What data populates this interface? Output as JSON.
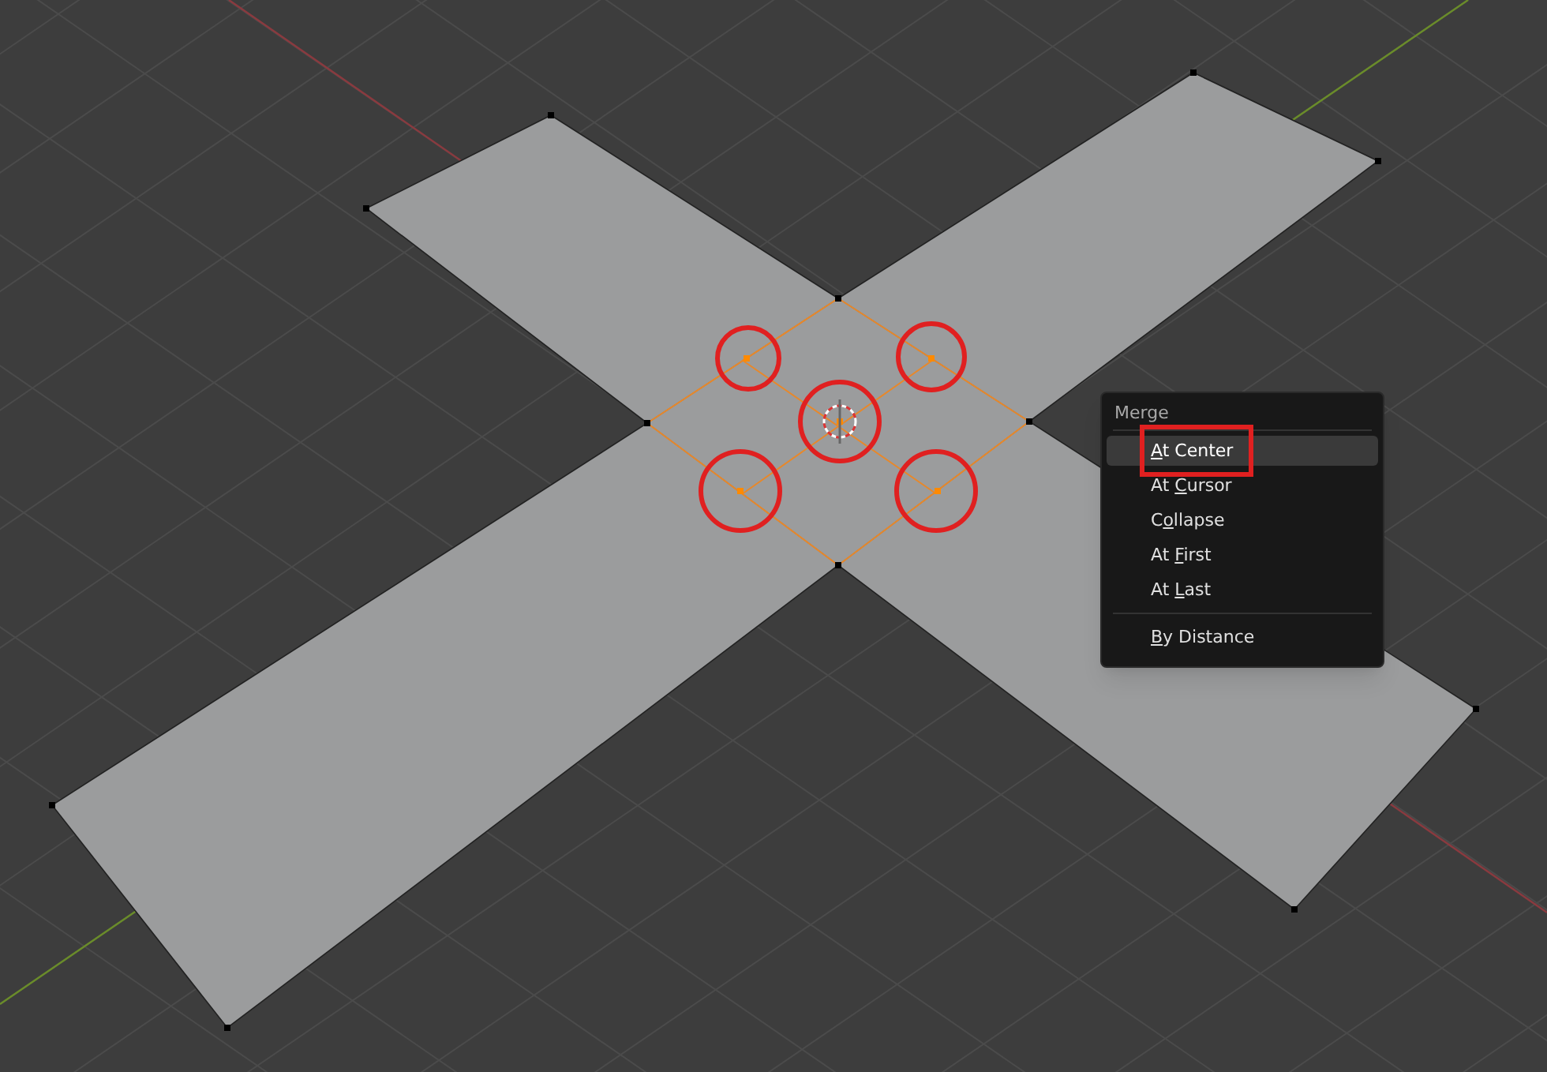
{
  "menu": {
    "title": "Merge",
    "items": [
      {
        "kind": "item",
        "key": "A",
        "after": "t Center",
        "selected": true,
        "outlined": true
      },
      {
        "kind": "item",
        "before": "At ",
        "key": "C",
        "after": "ursor",
        "selected": false,
        "outlined": false
      },
      {
        "kind": "item",
        "before": "C",
        "key": "o",
        "after": "llapse",
        "selected": false,
        "outlined": false
      },
      {
        "kind": "item",
        "before": "At ",
        "key": "F",
        "after": "irst",
        "selected": false,
        "outlined": false
      },
      {
        "kind": "item",
        "before": "At ",
        "key": "L",
        "after": "ast",
        "selected": false,
        "outlined": false
      },
      {
        "kind": "separator"
      },
      {
        "kind": "item",
        "key": "B",
        "after": "y Distance",
        "selected": false,
        "outlined": false
      }
    ]
  }
}
